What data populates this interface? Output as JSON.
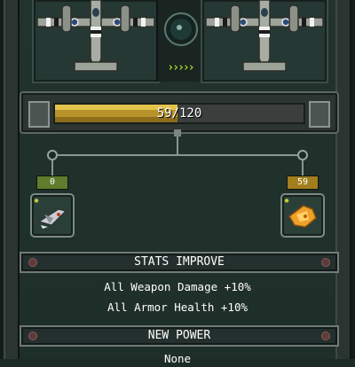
{
  "progress": {
    "current": 59,
    "max": 120,
    "label": "59/120"
  },
  "rewards": [
    {
      "count": "0",
      "item": "silver-plane-token",
      "badge_color": "#5f7d2c"
    },
    {
      "count": "59",
      "item": "gold-plane-token",
      "badge_color": "#a37e1d"
    }
  ],
  "center_arrows": "›››››",
  "stats_improve": {
    "title": "STATS IMPROVE",
    "lines": [
      "All Weapon Damage +10%",
      "All Armor Health +10%"
    ]
  },
  "new_power": {
    "title": "NEW POWER",
    "value": "None"
  },
  "icons": {
    "left_plane": "warplane-icon",
    "right_plane": "warplane-icon",
    "radar": "radar-icon",
    "gear": "gear-icon"
  },
  "colors": {
    "accent_green": "#a6d62e",
    "bar_gold": "#e3c24a",
    "panel_bg": "#263833"
  }
}
